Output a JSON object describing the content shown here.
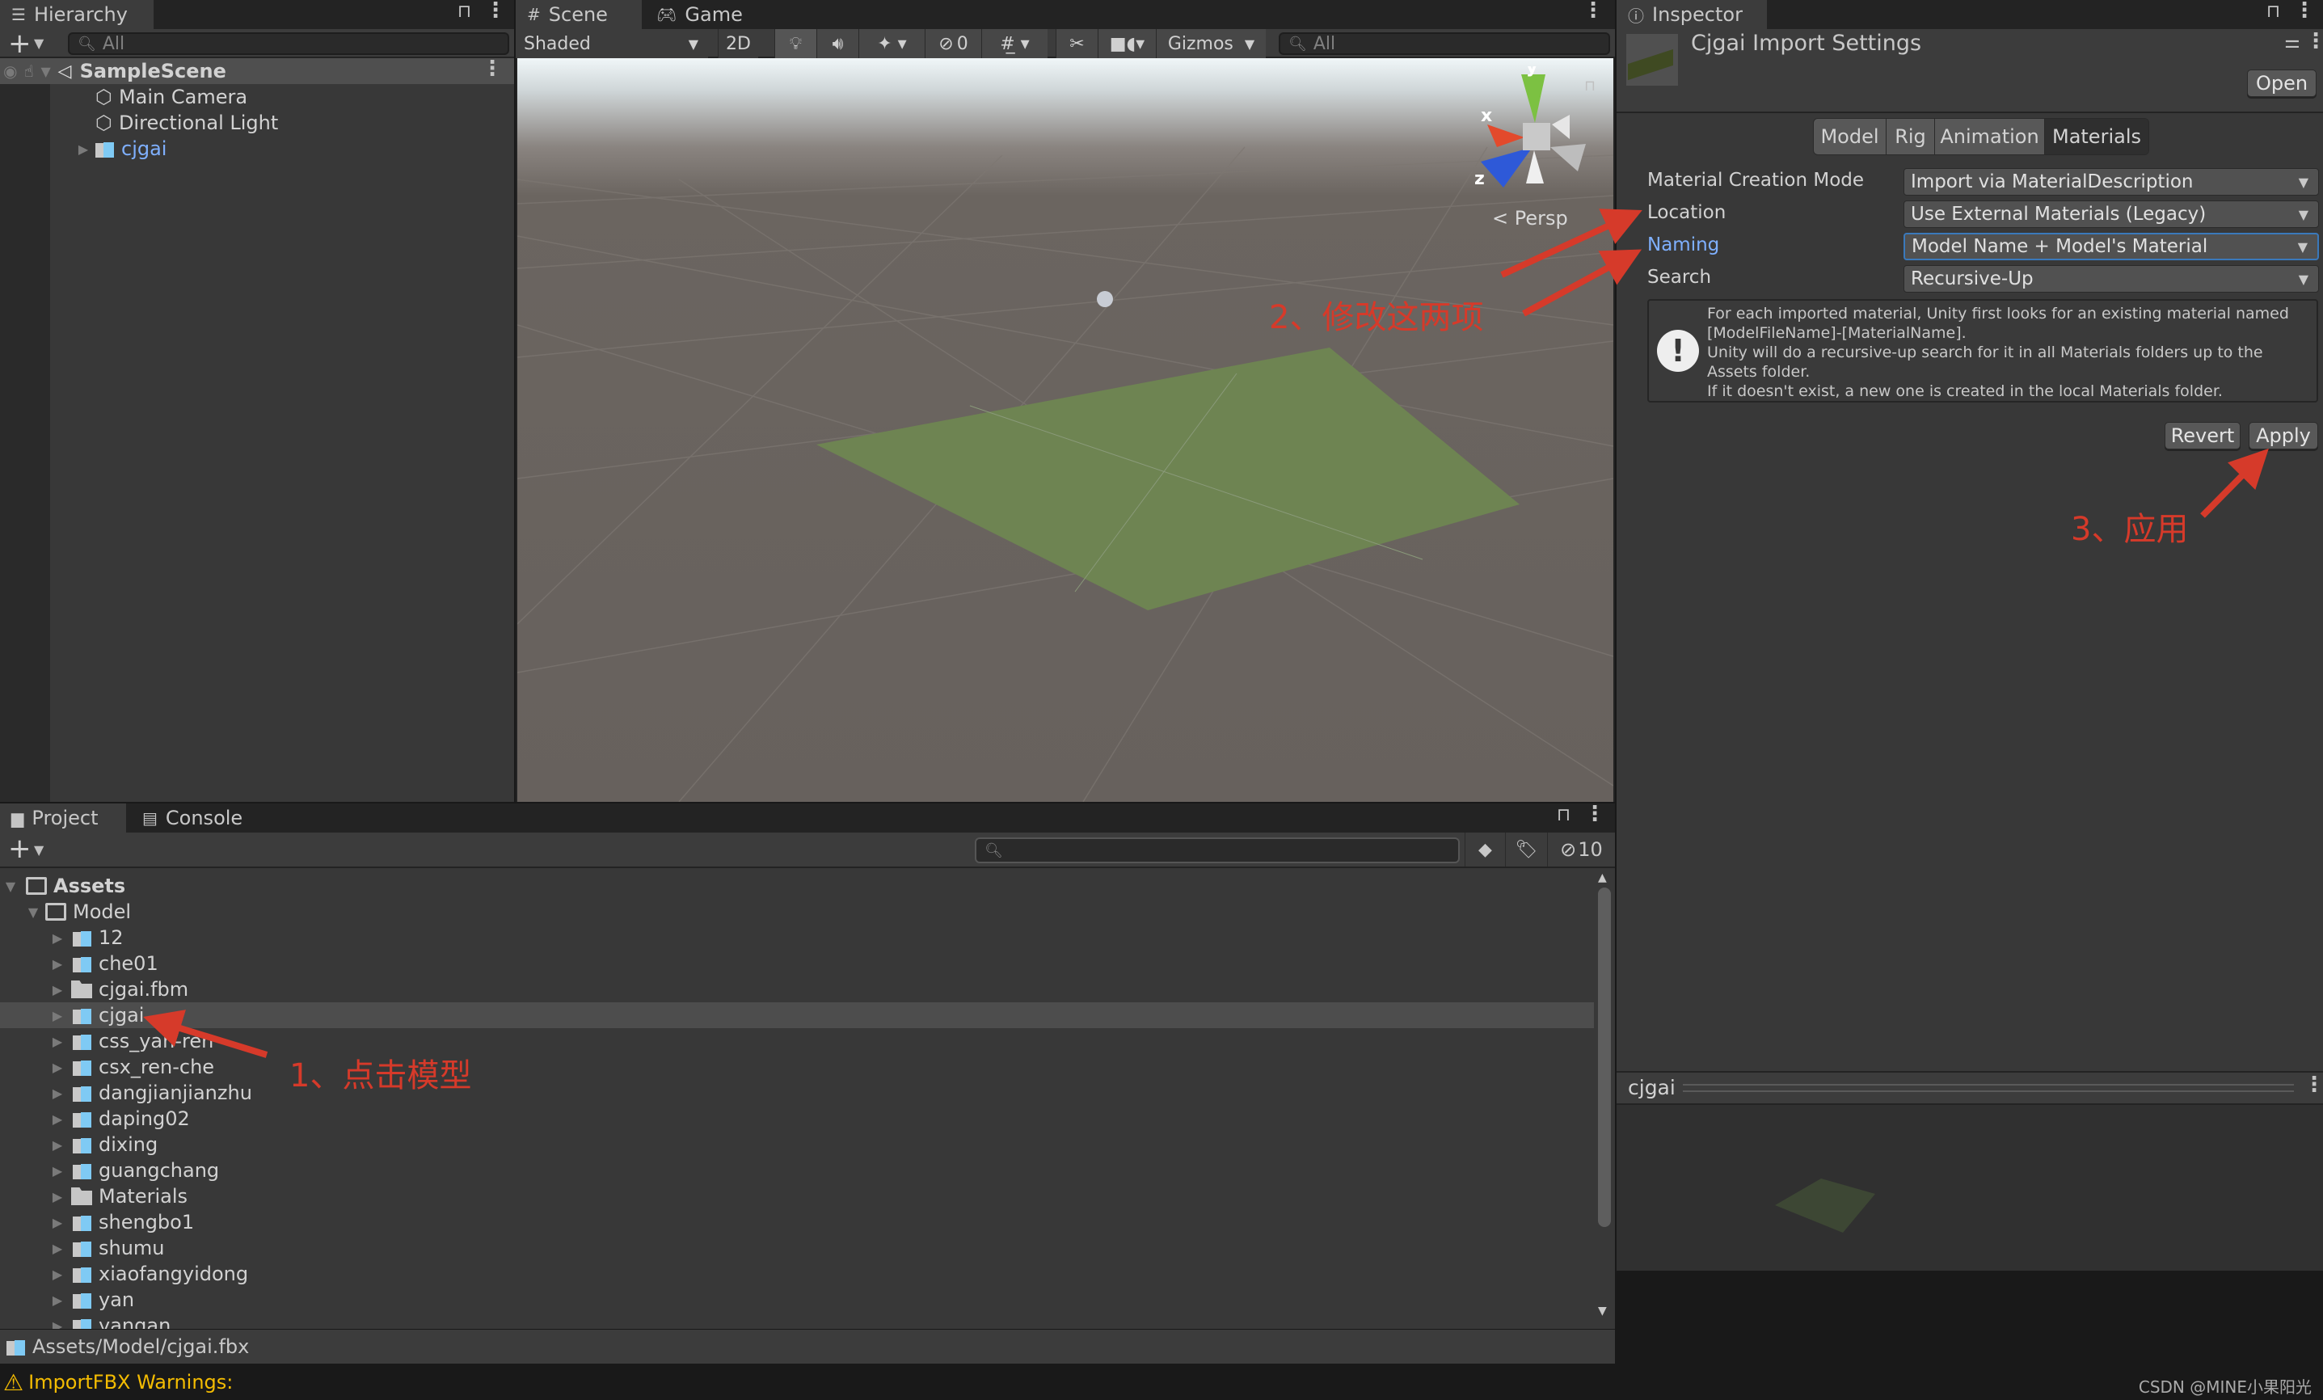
{
  "hierarchy": {
    "tab_label": "Hierarchy",
    "search_placeholder": "All",
    "scene_name": "SampleScene",
    "items": [
      {
        "label": "Main Camera",
        "icon": "gameobject-cube-icon"
      },
      {
        "label": "Directional Light",
        "icon": "gameobject-cube-icon"
      },
      {
        "label": "cjgai",
        "icon": "prefab-model-icon",
        "expandable": true
      }
    ]
  },
  "scene": {
    "tabs": [
      {
        "label": "Scene",
        "icon": "hash-icon"
      },
      {
        "label": "Game",
        "icon": "gamepad-icon"
      }
    ],
    "shading_mode": "Shaded",
    "toggle_2d": "2D",
    "hidden_count": "0",
    "gizmos_label": "Gizmos",
    "search_placeholder": "All",
    "projection_label": "Persp",
    "axis_labels": {
      "x": "x",
      "y": "y",
      "z": "z"
    }
  },
  "inspector": {
    "tab_label": "Inspector",
    "title": "Cjgai Import Settings",
    "open_button": "Open",
    "tabs": [
      "Model",
      "Rig",
      "Animation",
      "Materials"
    ],
    "active_tab": "Materials",
    "fields": [
      {
        "label": "Material Creation Mode",
        "value": "Import via MaterialDescription"
      },
      {
        "label": "Location",
        "value": "Use External Materials (Legacy)"
      },
      {
        "label": "Naming",
        "value": "Model Name + Model's Material",
        "focused": true
      },
      {
        "label": "Search",
        "value": "Recursive-Up"
      }
    ],
    "info_lines": [
      "For each imported material, Unity first looks for an existing material named",
      "[ModelFileName]-[MaterialName].",
      "Unity will do a recursive-up search for it in all Materials folders up to the",
      "Assets folder.",
      "If it doesn't exist, a new one is created in the local Materials folder."
    ],
    "revert_button": "Revert",
    "apply_button": "Apply",
    "preview_title": "cjgai"
  },
  "project": {
    "tabs": [
      {
        "label": "Project",
        "icon": "folder-icon"
      },
      {
        "label": "Console",
        "icon": "console-icon"
      }
    ],
    "hidden_count": "10",
    "root": "Assets",
    "folder": "Model",
    "items": [
      {
        "label": "12",
        "type": "model"
      },
      {
        "label": "che01",
        "type": "model"
      },
      {
        "label": "cjgai.fbm",
        "type": "folder"
      },
      {
        "label": "cjgai",
        "type": "model",
        "selected": true
      },
      {
        "label": "css_yan-ren",
        "type": "model"
      },
      {
        "label": "csx_ren-che",
        "type": "model"
      },
      {
        "label": "dangjianjianzhu",
        "type": "model"
      },
      {
        "label": "daping02",
        "type": "model"
      },
      {
        "label": "dixing",
        "type": "model"
      },
      {
        "label": "guangchang",
        "type": "model"
      },
      {
        "label": "Materials",
        "type": "folder"
      },
      {
        "label": "shengbo1",
        "type": "model"
      },
      {
        "label": "shumu",
        "type": "model"
      },
      {
        "label": "xiaofangyidong",
        "type": "model"
      },
      {
        "label": "yan",
        "type": "model"
      },
      {
        "label": "yangan",
        "type": "model"
      }
    ],
    "path": "Assets/Model/cjgai.fbx"
  },
  "status": {
    "message": "ImportFBX Warnings:",
    "watermark": "CSDN @MINE小果阳光"
  },
  "annotations": {
    "step1": "1、点击模型",
    "step2": "2、修改这两项",
    "step3": "3、应用"
  },
  "colors": {
    "accent_blue": "#3a79bb",
    "link_blue": "#7fb0ff",
    "annotation_red": "#d63a2a",
    "warning_yellow": "#f4bc02",
    "plane_green": "#6e8452"
  }
}
